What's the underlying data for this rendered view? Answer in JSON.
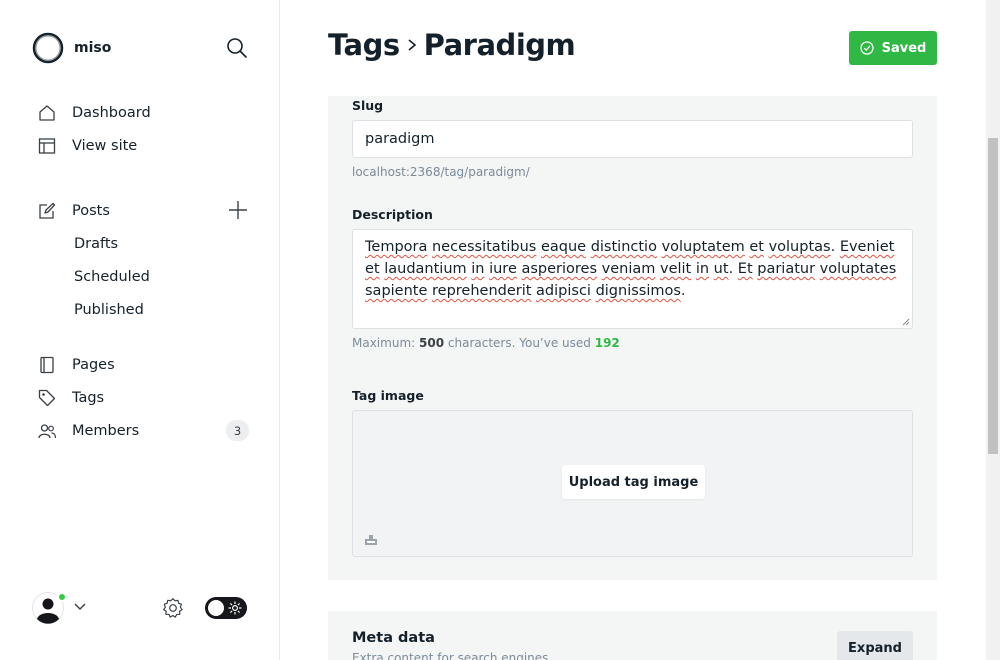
{
  "brand": {
    "name": "miso"
  },
  "nav": {
    "dashboard": "Dashboard",
    "view_site": "View site",
    "posts": "Posts",
    "drafts": "Drafts",
    "scheduled": "Scheduled",
    "published": "Published",
    "pages": "Pages",
    "tags": "Tags",
    "members": "Members",
    "members_count": "3"
  },
  "header": {
    "crumb": "Tags",
    "title": "Paradigm",
    "saved_label": "Saved"
  },
  "form": {
    "slug_label": "Slug",
    "slug_value": "paradigm",
    "slug_url": "localhost:2368/tag/paradigm/",
    "description_label": "Description",
    "description_words": [
      "Tempora",
      "necessitatibus",
      "eaque",
      "distinctio",
      "voluptatem",
      "et",
      "voluptas.",
      "Eveniet",
      "et",
      "laudantium",
      "in",
      "iure",
      "asperiores",
      "veniam",
      "velit",
      "in",
      "ut.",
      "Et",
      "pariatur",
      "voluptates",
      "sapiente",
      "reprehenderit",
      "adipisci",
      "dignissimos."
    ],
    "max_label": "Maximum:",
    "max_value": "500",
    "used_label": "characters. You’ve used",
    "used_value": "192",
    "tag_image_label": "Tag image",
    "upload_label": "Upload tag image"
  },
  "meta": {
    "title": "Meta data",
    "subtitle": "Extra content for search engines",
    "expand_label": "Expand"
  },
  "colors": {
    "accent_green": "#30b844",
    "online_dot": "#30cf43"
  }
}
